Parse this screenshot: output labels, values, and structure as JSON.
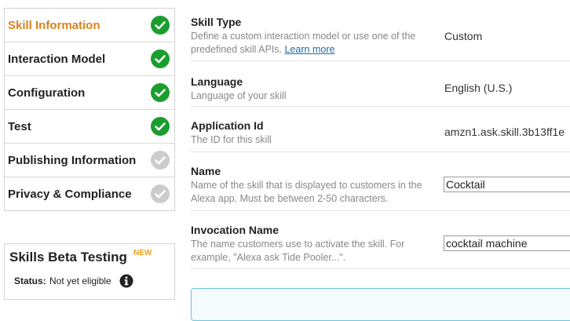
{
  "sidebar": {
    "steps": [
      {
        "label": "Skill Information",
        "status": "complete",
        "active": true
      },
      {
        "label": "Interaction Model",
        "status": "complete"
      },
      {
        "label": "Configuration",
        "status": "complete"
      },
      {
        "label": "Test",
        "status": "complete"
      },
      {
        "label": "Publishing Information",
        "status": "incomplete"
      },
      {
        "label": "Privacy & Compliance",
        "status": "incomplete"
      }
    ],
    "colors": {
      "complete": "#1a9e2f",
      "incomplete": "#cccccc",
      "active_label": "#d9831f"
    }
  },
  "beta": {
    "title": "Skills Beta Testing",
    "badge": "NEW",
    "status_label": "Status:",
    "status_value": "Not yet eligible",
    "info_icon": "info-circle-icon"
  },
  "form": {
    "skill_type": {
      "title": "Skill Type",
      "desc": "Define a custom interaction model or use one of the predefined skill APIs.",
      "link": "Learn more",
      "value": "Custom"
    },
    "language": {
      "title": "Language",
      "desc": "Language of your skill",
      "value": "English (U.S.)"
    },
    "app_id": {
      "title": "Application Id",
      "desc": "The ID for this skill",
      "value": "amzn1.ask.skill.3b13ff1e"
    },
    "name": {
      "title": "Name",
      "desc": "Name of the skill that is displayed to customers in the Alexa app. Must be between 2-50 characters.",
      "value": "Cocktail"
    },
    "invocation": {
      "title": "Invocation Name",
      "desc": "The name customers use to activate the skill. For example, \"Alexa ask Tide Pooler...\".",
      "value": "cocktail machine"
    }
  }
}
